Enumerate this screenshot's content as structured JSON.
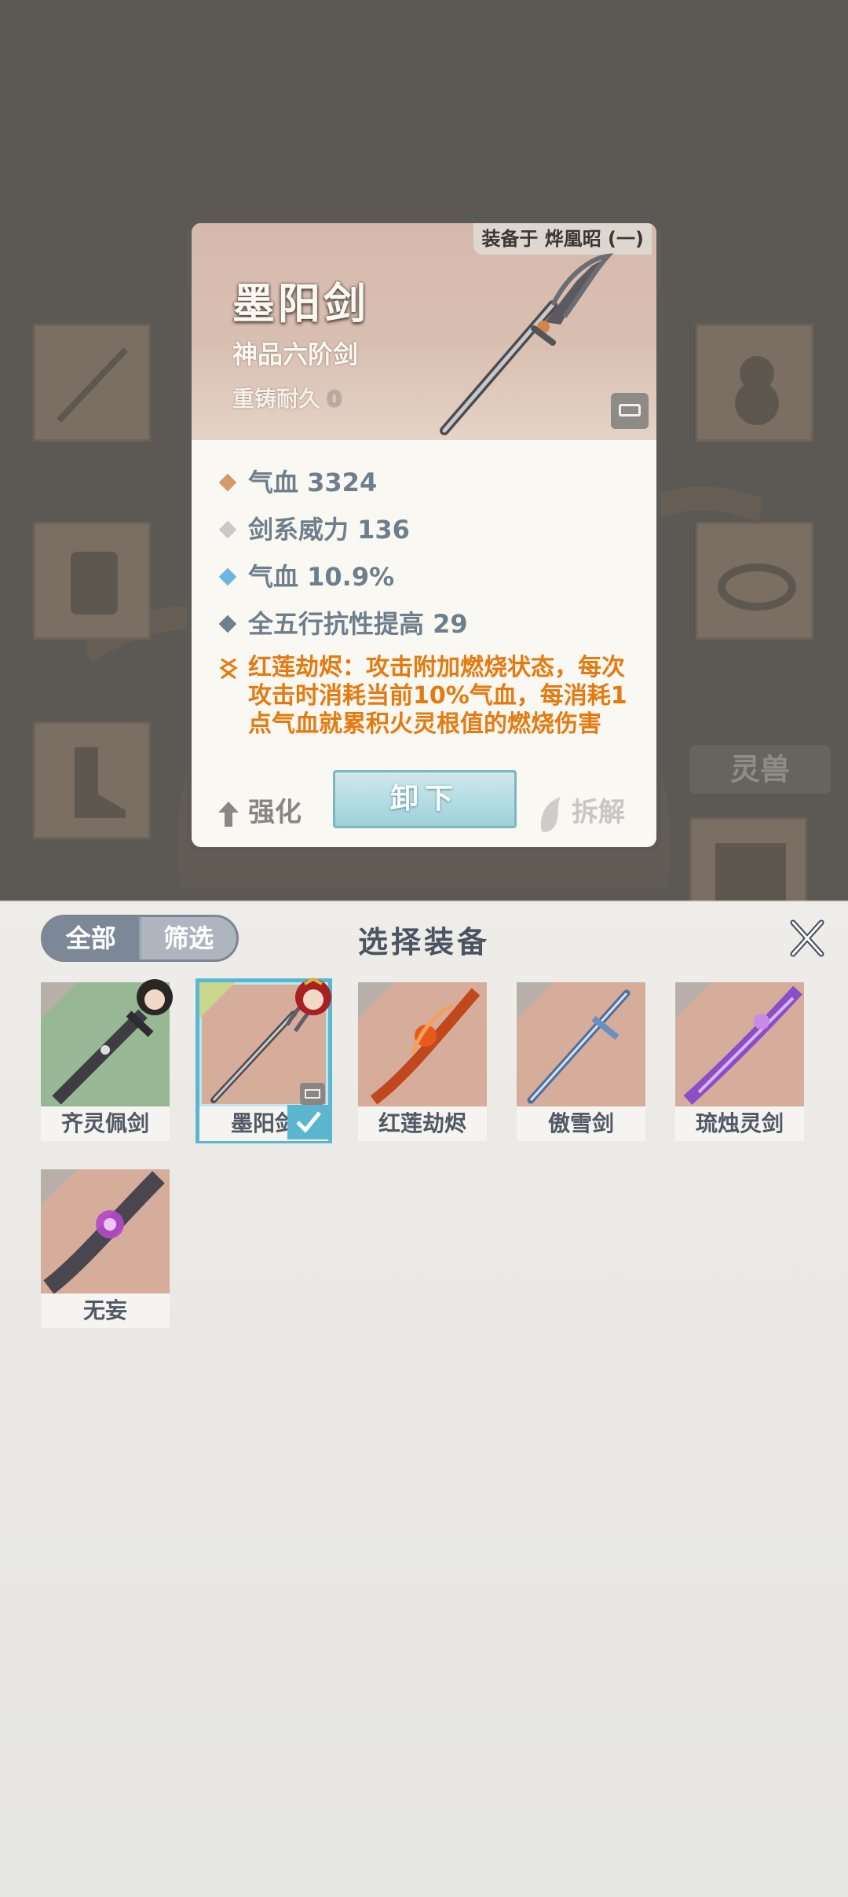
{
  "background": {
    "spirit_tab_label": "灵兽"
  },
  "detail_card": {
    "equipped_on": "装备于 烨凰昭 (一)",
    "name": "墨阳剑",
    "grade": "神品六阶剑",
    "durability_label": "重铸耐久",
    "durability_value": "0",
    "stats": [
      {
        "text": "气血 3324",
        "color": "#d49a6a"
      },
      {
        "text": "剑系威力 136",
        "color": "#c9c9c9"
      },
      {
        "text": "气血 10.9%",
        "color": "#6cb6df"
      },
      {
        "text": "全五行抗性提高 29",
        "color": "#6e7f92"
      }
    ],
    "skill_text": "红莲劫烬：攻击附加燃烧状态，每次攻击时消耗当前10%气血，每消耗1点气血就累积火灵根值的燃烧伤害",
    "strengthen_label": "强化",
    "unequip_label": "卸下",
    "dismantle_label": "拆解"
  },
  "panel": {
    "tab_all": "全部",
    "tab_filter": "筛选",
    "title": "选择装备",
    "items": [
      {
        "name": "齐灵佩剑",
        "bg": "green",
        "has_avatar": true,
        "selected": false
      },
      {
        "name": "墨阳剑",
        "bg": "rose",
        "has_avatar": true,
        "selected": true
      },
      {
        "name": "红莲劫烬",
        "bg": "rose",
        "has_avatar": false,
        "selected": false
      },
      {
        "name": "傲雪剑",
        "bg": "rose",
        "has_avatar": false,
        "selected": false
      },
      {
        "name": "琉烛灵剑",
        "bg": "rose",
        "has_avatar": false,
        "selected": false
      },
      {
        "name": "无妄",
        "bg": "rose",
        "has_avatar": false,
        "selected": false
      }
    ]
  }
}
